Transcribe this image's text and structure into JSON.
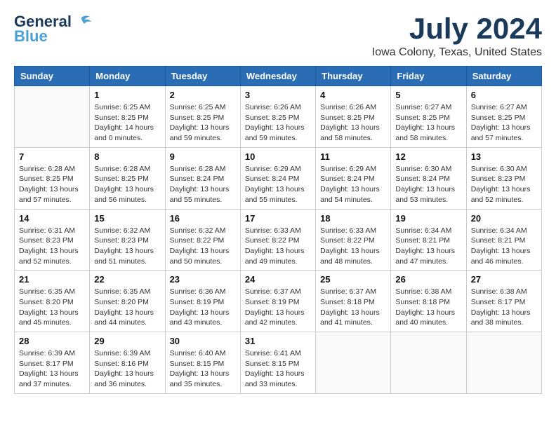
{
  "logo": {
    "general": "General",
    "blue": "Blue"
  },
  "header": {
    "month": "July 2024",
    "location": "Iowa Colony, Texas, United States"
  },
  "weekdays": [
    "Sunday",
    "Monday",
    "Tuesday",
    "Wednesday",
    "Thursday",
    "Friday",
    "Saturday"
  ],
  "weeks": [
    [
      {
        "day": "",
        "info": ""
      },
      {
        "day": "1",
        "info": "Sunrise: 6:25 AM\nSunset: 8:25 PM\nDaylight: 14 hours\nand 0 minutes."
      },
      {
        "day": "2",
        "info": "Sunrise: 6:25 AM\nSunset: 8:25 PM\nDaylight: 13 hours\nand 59 minutes."
      },
      {
        "day": "3",
        "info": "Sunrise: 6:26 AM\nSunset: 8:25 PM\nDaylight: 13 hours\nand 59 minutes."
      },
      {
        "day": "4",
        "info": "Sunrise: 6:26 AM\nSunset: 8:25 PM\nDaylight: 13 hours\nand 58 minutes."
      },
      {
        "day": "5",
        "info": "Sunrise: 6:27 AM\nSunset: 8:25 PM\nDaylight: 13 hours\nand 58 minutes."
      },
      {
        "day": "6",
        "info": "Sunrise: 6:27 AM\nSunset: 8:25 PM\nDaylight: 13 hours\nand 57 minutes."
      }
    ],
    [
      {
        "day": "7",
        "info": "Sunrise: 6:28 AM\nSunset: 8:25 PM\nDaylight: 13 hours\nand 57 minutes."
      },
      {
        "day": "8",
        "info": "Sunrise: 6:28 AM\nSunset: 8:25 PM\nDaylight: 13 hours\nand 56 minutes."
      },
      {
        "day": "9",
        "info": "Sunrise: 6:28 AM\nSunset: 8:24 PM\nDaylight: 13 hours\nand 55 minutes."
      },
      {
        "day": "10",
        "info": "Sunrise: 6:29 AM\nSunset: 8:24 PM\nDaylight: 13 hours\nand 55 minutes."
      },
      {
        "day": "11",
        "info": "Sunrise: 6:29 AM\nSunset: 8:24 PM\nDaylight: 13 hours\nand 54 minutes."
      },
      {
        "day": "12",
        "info": "Sunrise: 6:30 AM\nSunset: 8:24 PM\nDaylight: 13 hours\nand 53 minutes."
      },
      {
        "day": "13",
        "info": "Sunrise: 6:30 AM\nSunset: 8:23 PM\nDaylight: 13 hours\nand 52 minutes."
      }
    ],
    [
      {
        "day": "14",
        "info": "Sunrise: 6:31 AM\nSunset: 8:23 PM\nDaylight: 13 hours\nand 52 minutes."
      },
      {
        "day": "15",
        "info": "Sunrise: 6:32 AM\nSunset: 8:23 PM\nDaylight: 13 hours\nand 51 minutes."
      },
      {
        "day": "16",
        "info": "Sunrise: 6:32 AM\nSunset: 8:22 PM\nDaylight: 13 hours\nand 50 minutes."
      },
      {
        "day": "17",
        "info": "Sunrise: 6:33 AM\nSunset: 8:22 PM\nDaylight: 13 hours\nand 49 minutes."
      },
      {
        "day": "18",
        "info": "Sunrise: 6:33 AM\nSunset: 8:22 PM\nDaylight: 13 hours\nand 48 minutes."
      },
      {
        "day": "19",
        "info": "Sunrise: 6:34 AM\nSunset: 8:21 PM\nDaylight: 13 hours\nand 47 minutes."
      },
      {
        "day": "20",
        "info": "Sunrise: 6:34 AM\nSunset: 8:21 PM\nDaylight: 13 hours\nand 46 minutes."
      }
    ],
    [
      {
        "day": "21",
        "info": "Sunrise: 6:35 AM\nSunset: 8:20 PM\nDaylight: 13 hours\nand 45 minutes."
      },
      {
        "day": "22",
        "info": "Sunrise: 6:35 AM\nSunset: 8:20 PM\nDaylight: 13 hours\nand 44 minutes."
      },
      {
        "day": "23",
        "info": "Sunrise: 6:36 AM\nSunset: 8:19 PM\nDaylight: 13 hours\nand 43 minutes."
      },
      {
        "day": "24",
        "info": "Sunrise: 6:37 AM\nSunset: 8:19 PM\nDaylight: 13 hours\nand 42 minutes."
      },
      {
        "day": "25",
        "info": "Sunrise: 6:37 AM\nSunset: 8:18 PM\nDaylight: 13 hours\nand 41 minutes."
      },
      {
        "day": "26",
        "info": "Sunrise: 6:38 AM\nSunset: 8:18 PM\nDaylight: 13 hours\nand 40 minutes."
      },
      {
        "day": "27",
        "info": "Sunrise: 6:38 AM\nSunset: 8:17 PM\nDaylight: 13 hours\nand 38 minutes."
      }
    ],
    [
      {
        "day": "28",
        "info": "Sunrise: 6:39 AM\nSunset: 8:17 PM\nDaylight: 13 hours\nand 37 minutes."
      },
      {
        "day": "29",
        "info": "Sunrise: 6:39 AM\nSunset: 8:16 PM\nDaylight: 13 hours\nand 36 minutes."
      },
      {
        "day": "30",
        "info": "Sunrise: 6:40 AM\nSunset: 8:15 PM\nDaylight: 13 hours\nand 35 minutes."
      },
      {
        "day": "31",
        "info": "Sunrise: 6:41 AM\nSunset: 8:15 PM\nDaylight: 13 hours\nand 33 minutes."
      },
      {
        "day": "",
        "info": ""
      },
      {
        "day": "",
        "info": ""
      },
      {
        "day": "",
        "info": ""
      }
    ]
  ]
}
